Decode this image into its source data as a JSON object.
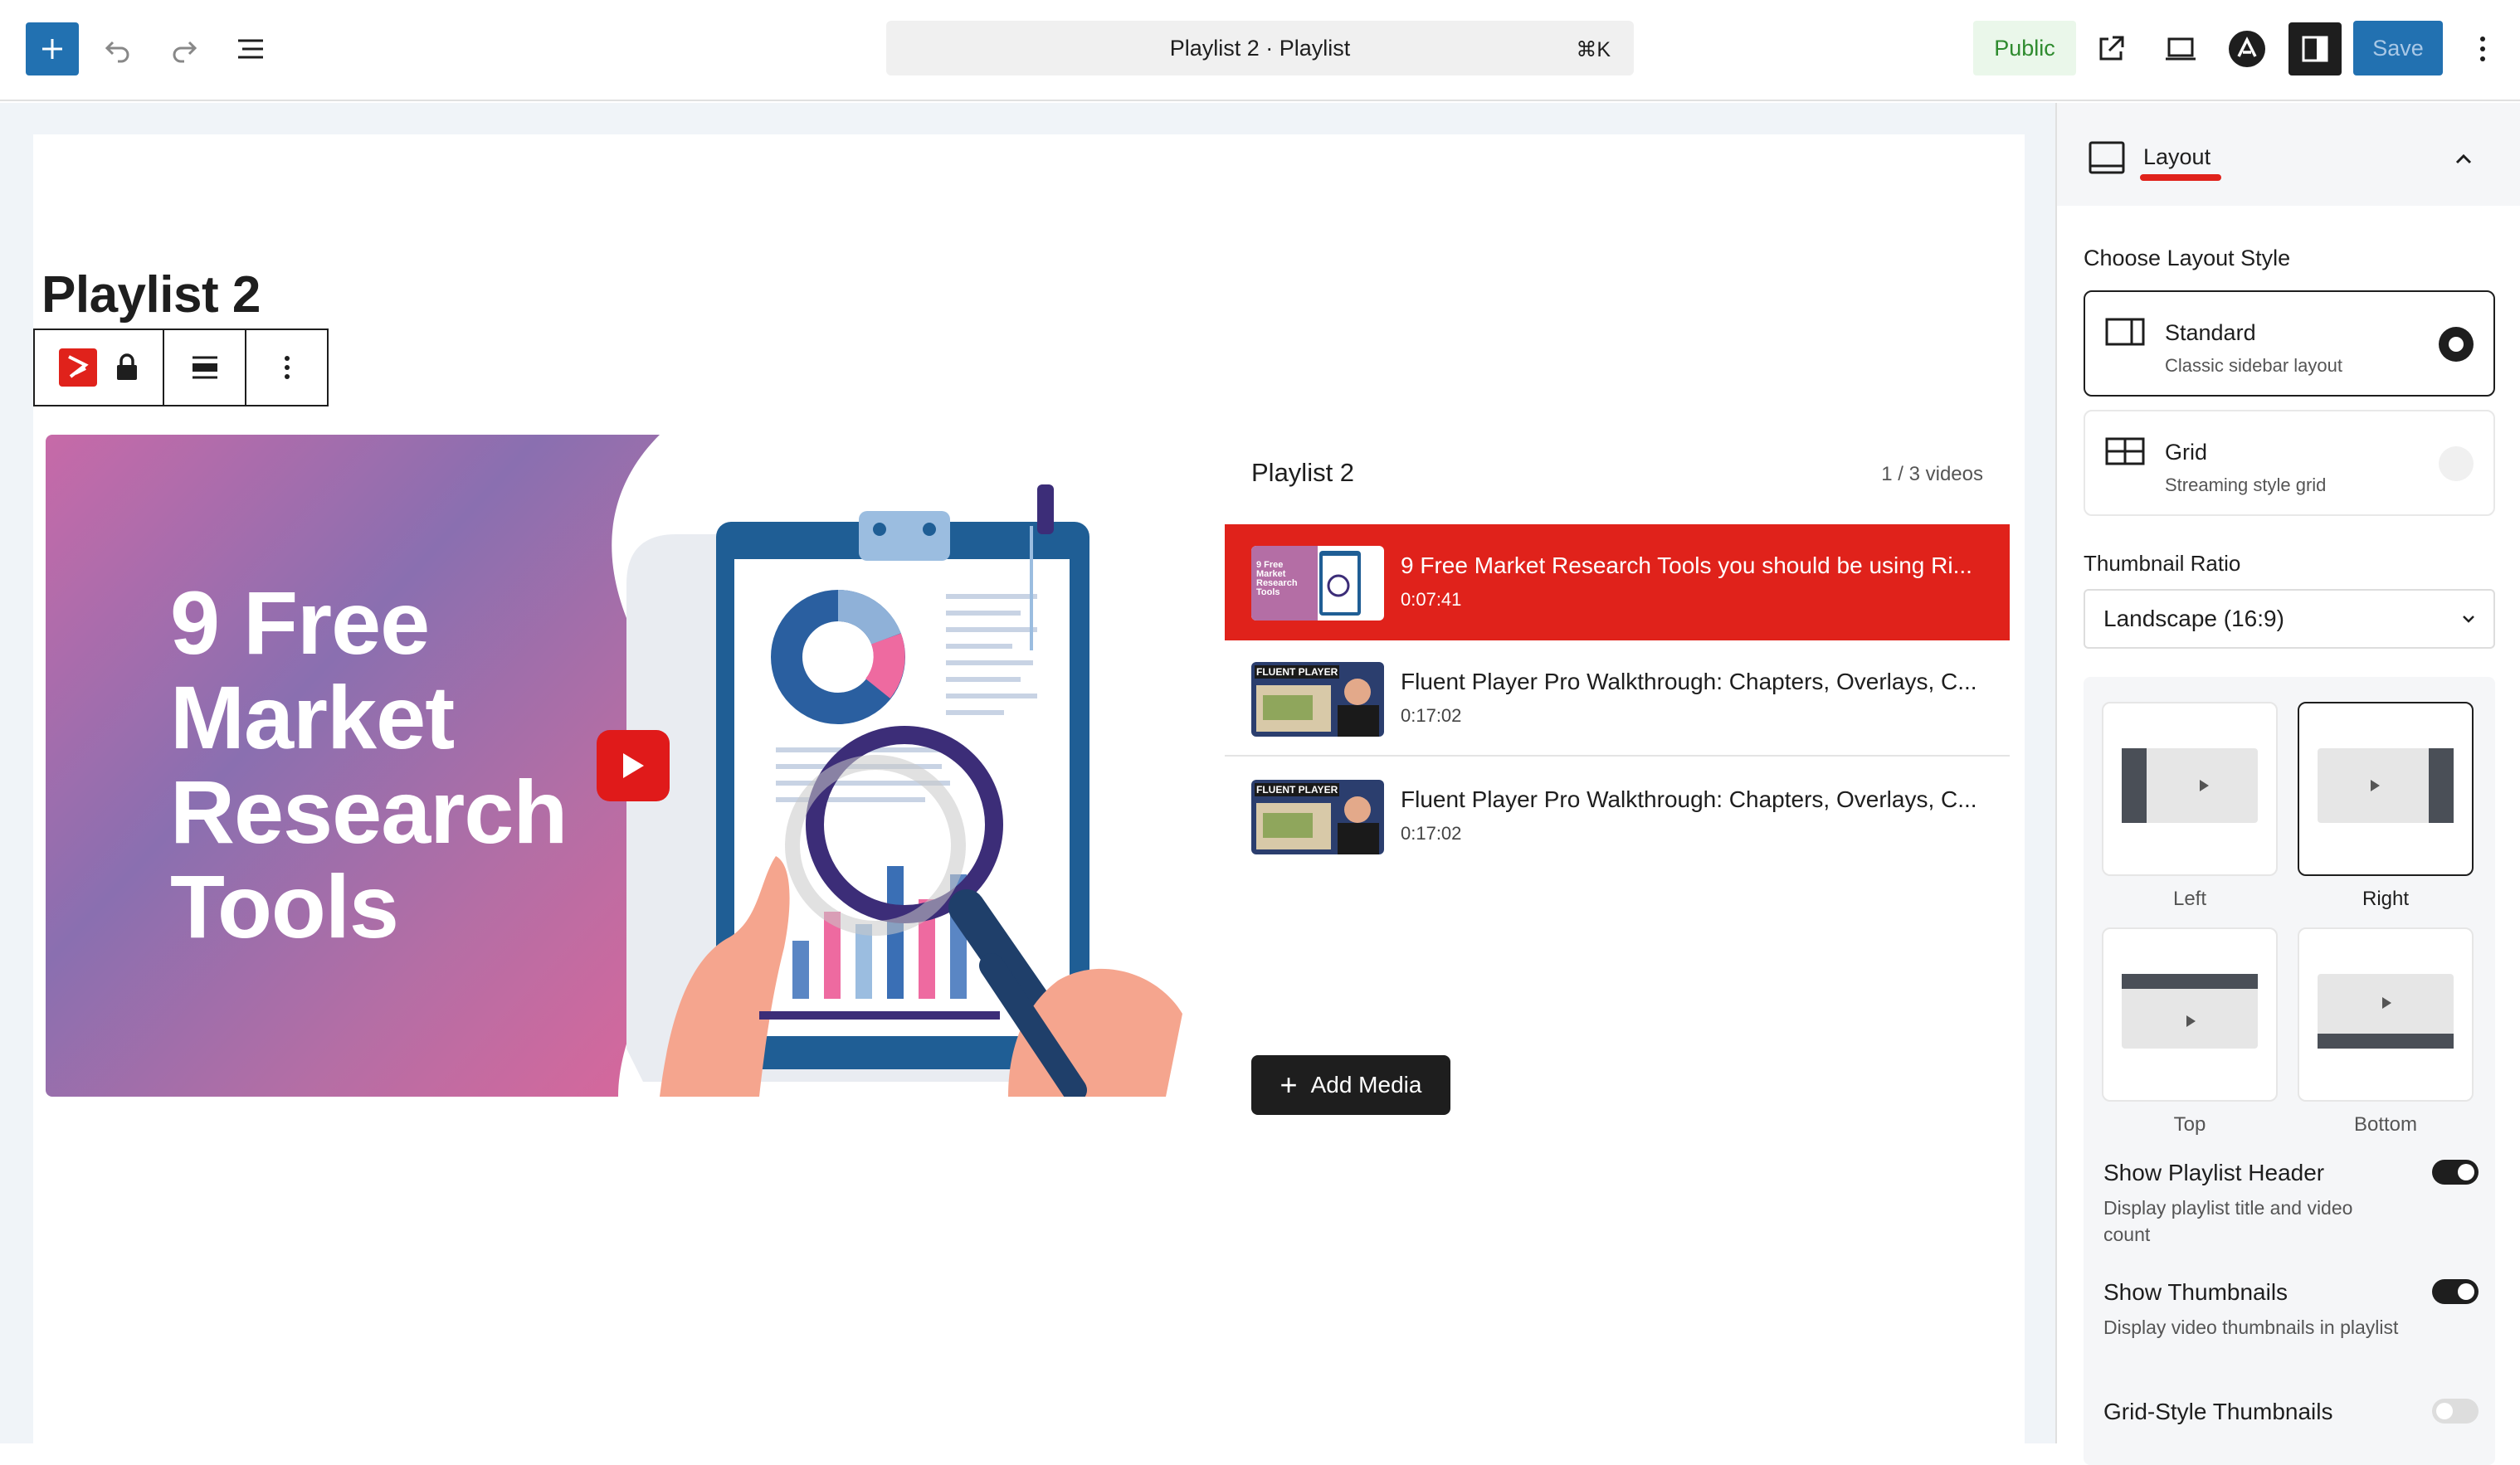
{
  "topbar": {
    "command_title": "Playlist 2 · Playlist",
    "command_shortcut": "⌘K",
    "public_label": "Public",
    "save_label": "Save"
  },
  "editor": {
    "page_title": "Playlist 2",
    "hero_text": "9 Free Market Research Tools"
  },
  "playlist": {
    "header_title": "Playlist 2",
    "count": "1 / 3 videos",
    "items": [
      {
        "title": "9 Free Market Research Tools you should be using Ri...",
        "duration": "0:07:41",
        "thumb_text": "9 Free Market Research Tools"
      },
      {
        "title": "Fluent Player Pro Walkthrough: Chapters, Overlays, C...",
        "duration": "0:17:02",
        "thumb_text": "FLUENT PLAYER"
      },
      {
        "title": "Fluent Player Pro Walkthrough: Chapters, Overlays, C...",
        "duration": "0:17:02",
        "thumb_text": "FLUENT PLAYER"
      }
    ],
    "add_media_label": "Add Media"
  },
  "sidebar": {
    "tab_label": "Layout",
    "choose_layout_label": "Choose Layout Style",
    "layouts": [
      {
        "title": "Standard",
        "subtitle": "Classic sidebar layout",
        "selected": true
      },
      {
        "title": "Grid",
        "subtitle": "Streaming style grid",
        "selected": false
      }
    ],
    "thumbnail_ratio_label": "Thumbnail Ratio",
    "thumbnail_ratio_value": "Landscape (16:9)",
    "positions": [
      {
        "label": "Left",
        "selected": false
      },
      {
        "label": "Right",
        "selected": true
      },
      {
        "label": "Top",
        "selected": false
      },
      {
        "label": "Bottom",
        "selected": false
      }
    ],
    "toggles": [
      {
        "title": "Show Playlist Header",
        "description": "Display playlist title and video count",
        "on": true
      },
      {
        "title": "Show Thumbnails",
        "description": "Display video thumbnails in playlist",
        "on": true
      },
      {
        "title": "Grid-Style Thumbnails",
        "description": "",
        "on": false
      }
    ]
  },
  "colors": {
    "accent": "#2271b1",
    "playlist_active": "#e0221b",
    "public_text": "#2e8b2e"
  }
}
